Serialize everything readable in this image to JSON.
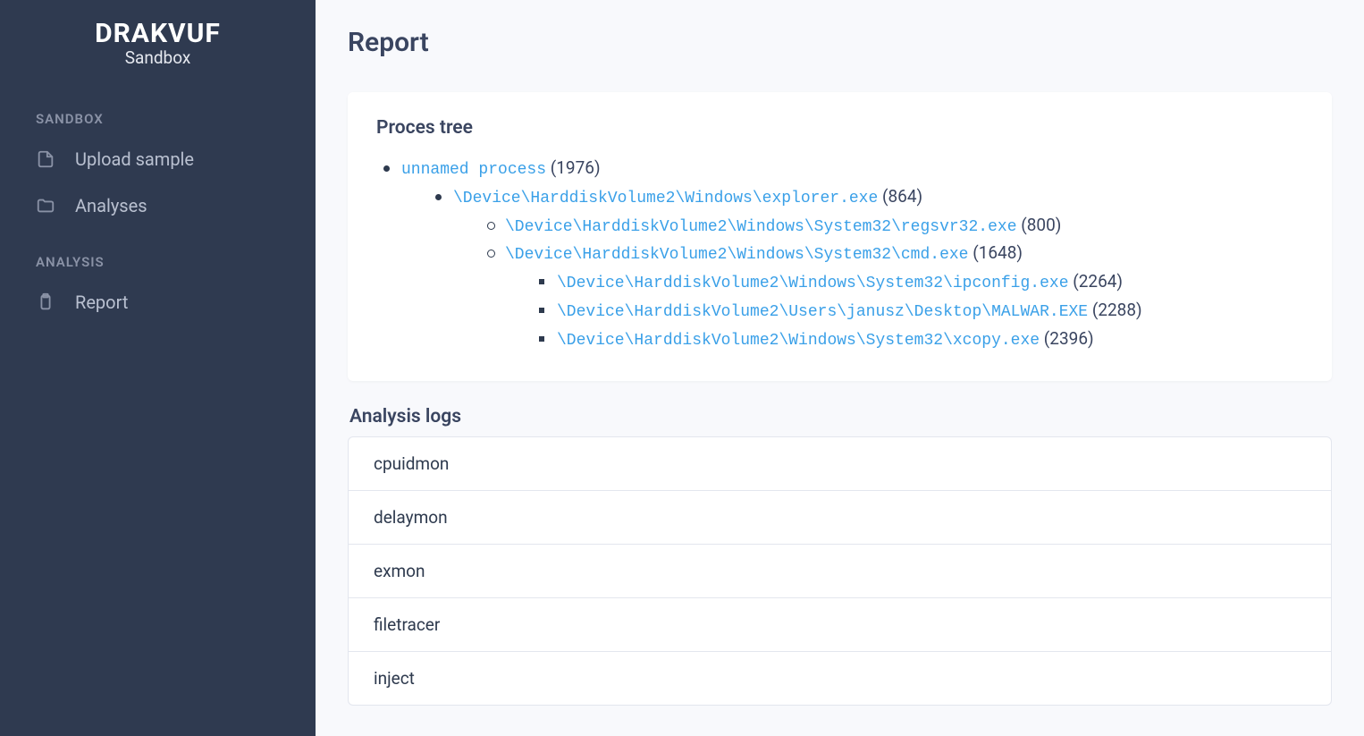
{
  "brand": {
    "title": "DRAKVUF",
    "subtitle": "Sandbox"
  },
  "sidebar": {
    "sections": [
      {
        "label": "SANDBOX",
        "items": [
          {
            "label": "Upload sample",
            "icon": "file-icon"
          },
          {
            "label": "Analyses",
            "icon": "folder-icon"
          }
        ]
      },
      {
        "label": "ANALYSIS",
        "items": [
          {
            "label": "Report",
            "icon": "clipboard-icon"
          }
        ]
      }
    ]
  },
  "page": {
    "title": "Report"
  },
  "process_tree": {
    "title": "Proces tree",
    "root": {
      "name": "unnamed process",
      "pid": "1976",
      "children": [
        {
          "name": "\\Device\\HarddiskVolume2\\Windows\\explorer.exe",
          "pid": "864",
          "children": [
            {
              "name": "\\Device\\HarddiskVolume2\\Windows\\System32\\regsvr32.exe",
              "pid": "800",
              "children": []
            },
            {
              "name": "\\Device\\HarddiskVolume2\\Windows\\System32\\cmd.exe",
              "pid": "1648",
              "children": [
                {
                  "name": "\\Device\\HarddiskVolume2\\Windows\\System32\\ipconfig.exe",
                  "pid": "2264",
                  "children": []
                },
                {
                  "name": "\\Device\\HarddiskVolume2\\Users\\janusz\\Desktop\\MALWAR.EXE",
                  "pid": "2288",
                  "children": []
                },
                {
                  "name": "\\Device\\HarddiskVolume2\\Windows\\System32\\xcopy.exe",
                  "pid": "2396",
                  "children": []
                }
              ]
            }
          ]
        }
      ]
    }
  },
  "analysis_logs": {
    "title": "Analysis logs",
    "items": [
      "cpuidmon",
      "delaymon",
      "exmon",
      "filetracer",
      "inject"
    ]
  }
}
